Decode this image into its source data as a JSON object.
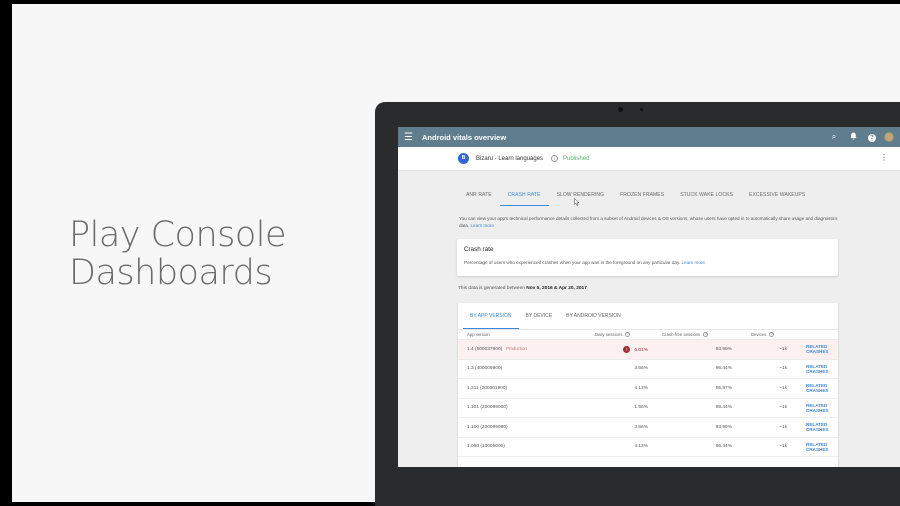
{
  "slide": {
    "title_line1": "Play Console",
    "title_line2": "Dashboards"
  },
  "appbar": {
    "menu_icon": "☰",
    "title": "Android vitals overview",
    "search_icon": "⌕",
    "bell_icon": "🔔",
    "help_icon": "?"
  },
  "app": {
    "logo_text": "B",
    "name": "Bizaru - Learn languages",
    "info_icon": "i",
    "status": "Published",
    "status_color": "#5ab36a",
    "more_icon": "⋮"
  },
  "tabs": [
    {
      "label": "ANR RATE",
      "active": false
    },
    {
      "label": "CRASH RATE",
      "active": true
    },
    {
      "label": "SLOW RENDERING",
      "active": false
    },
    {
      "label": "FROZEN FRAMES",
      "active": false
    },
    {
      "label": "STUCK WAKE LOCKS",
      "active": false
    },
    {
      "label": "EXCESSIVE WAKEUPS",
      "active": false
    }
  ],
  "intro": {
    "text": "You can view your app's technical performance details collected from a subset of Android devices & OS versions, whose users have opted in to automatically share usage and diagnostics data.",
    "link": "Learn more"
  },
  "crash_card": {
    "title": "Crash rate",
    "description": "Percentage of users who experienced crashes when your app was in the foreground on any particular day.",
    "link": "Learn more"
  },
  "generated": {
    "prefix": "This data is generated between ",
    "range": "Nov 5, 2016 & Apr 20, 2017"
  },
  "subtabs": [
    {
      "label": "BY APP VERSION",
      "active": true
    },
    {
      "label": "BY DEVICE",
      "active": false
    },
    {
      "label": "BY ANDROID VERSION",
      "active": false
    }
  ],
  "table": {
    "headers": {
      "version": "App version",
      "daily": "Daily sessions",
      "crash_free": "Crash-free sessions",
      "devices": "Devices"
    },
    "help_icon": "?",
    "alert_icon": "!",
    "accent_color": "#3b8ad8",
    "alert_color": "#a2303a",
    "rows": [
      {
        "version": "1.4 (500037600)",
        "tag": "Production",
        "daily": "6.01%",
        "crash_free": "93.99%",
        "devices": "~1k",
        "action": "RELATED CRASHES",
        "alert": true
      },
      {
        "version": "1.3 (400009900)",
        "tag": "",
        "daily": "3.56%",
        "crash_free": "96.44%",
        "devices": "~1k",
        "action": "RELATED CRASHES",
        "alert": false
      },
      {
        "version": "1.211 (200001900)",
        "tag": "",
        "daily": "4.13%",
        "crash_free": "95.87%",
        "devices": "~1k",
        "action": "RELATED CRASHES",
        "alert": false
      },
      {
        "version": "1.101 (200099900)",
        "tag": "",
        "daily": "1.56%",
        "crash_free": "98.44%",
        "devices": "~1k",
        "action": "RELATED CRASHES",
        "alert": false
      },
      {
        "version": "1.100 (200099990)",
        "tag": "",
        "daily": "3.56%",
        "crash_free": "93.99%",
        "devices": "~1k",
        "action": "RELATED CRASHES",
        "alert": false
      },
      {
        "version": "1.050 (10005000)",
        "tag": "",
        "daily": "4.13%",
        "crash_free": "96.44%",
        "devices": "~1k",
        "action": "RELATED CRASHES",
        "alert": false
      }
    ]
  }
}
